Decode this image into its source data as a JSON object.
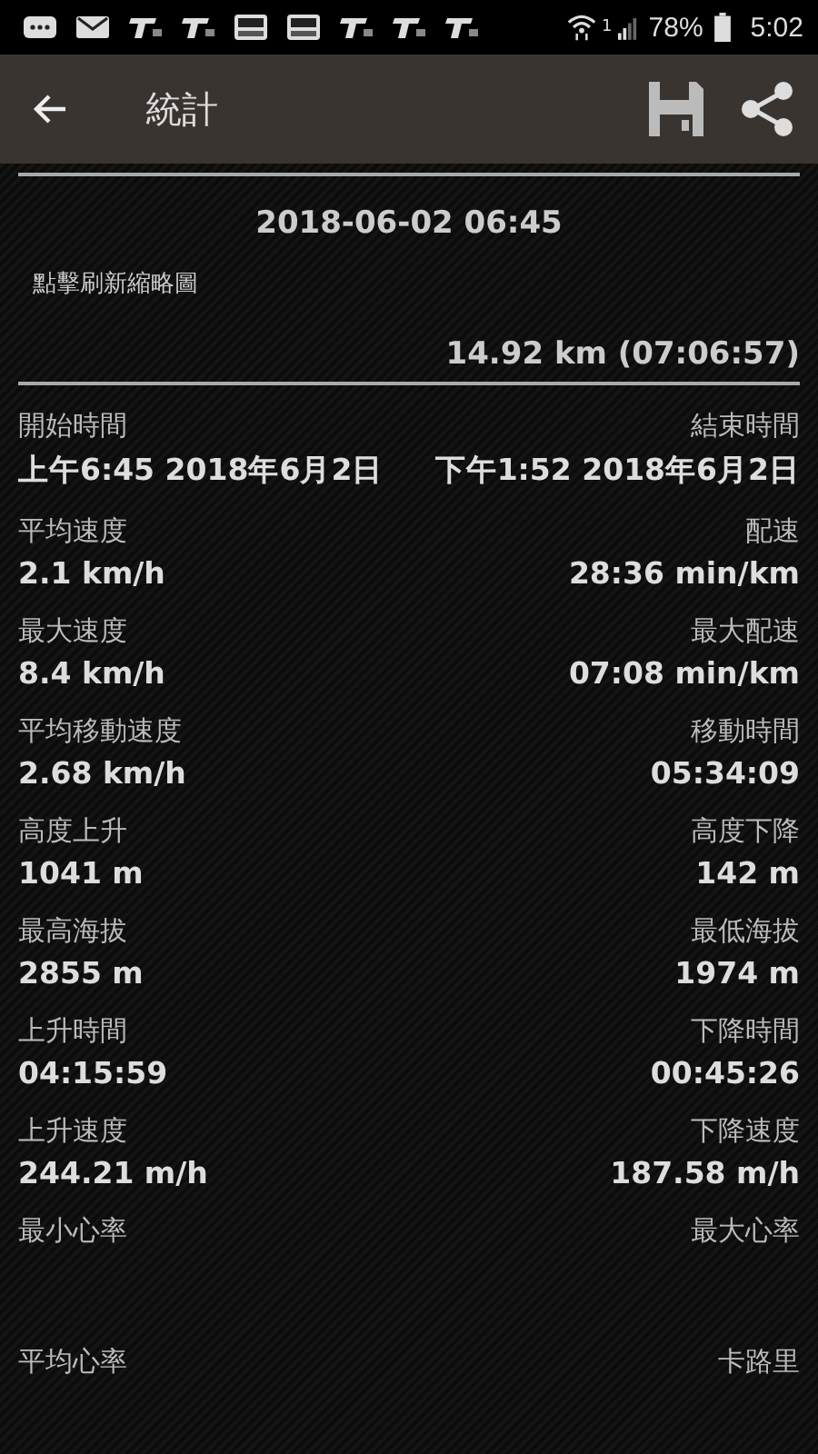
{
  "status_bar": {
    "notifications": [
      {
        "kind": "message"
      },
      {
        "kind": "mail"
      },
      {
        "kind": "app"
      },
      {
        "kind": "app"
      },
      {
        "kind": "news"
      },
      {
        "kind": "news"
      },
      {
        "kind": "app"
      },
      {
        "kind": "app"
      },
      {
        "kind": "app"
      }
    ],
    "signal_label": "1",
    "battery": "78%",
    "time": "5:02"
  },
  "app_bar": {
    "title": "統計"
  },
  "summary": {
    "date": "2018-06-02 06:45",
    "thumbnail_hint": "點擊刷新縮略圖",
    "distance": "14.92 km (07:06:57)"
  },
  "stats": [
    {
      "left_label": "開始時間",
      "left_value": "上午6:45 2018年6月2日",
      "right_label": "結束時間",
      "right_value": "下午1:52 2018年6月2日"
    },
    {
      "left_label": "平均速度",
      "left_value": "2.1 km/h",
      "right_label": "配速",
      "right_value": "28:36 min/km"
    },
    {
      "left_label": "最大速度",
      "left_value": "8.4 km/h",
      "right_label": "最大配速",
      "right_value": "07:08 min/km"
    },
    {
      "left_label": "平均移動速度",
      "left_value": "2.68 km/h",
      "right_label": "移動時間",
      "right_value": "05:34:09"
    },
    {
      "left_label": "高度上升",
      "left_value": "1041 m",
      "right_label": "高度下降",
      "right_value": "142 m"
    },
    {
      "left_label": "最高海拔",
      "left_value": "2855 m",
      "right_label": "最低海拔",
      "right_value": "1974 m"
    },
    {
      "left_label": "上升時間",
      "left_value": "04:15:59",
      "right_label": "下降時間",
      "right_value": "00:45:26"
    },
    {
      "left_label": "上升速度",
      "left_value": "244.21 m/h",
      "right_label": "下降速度",
      "right_value": "187.58 m/h"
    },
    {
      "left_label": "最小心率",
      "right_label": "最大心率"
    },
    {
      "left_label": "平均心率",
      "right_label": "卡路里"
    }
  ]
}
